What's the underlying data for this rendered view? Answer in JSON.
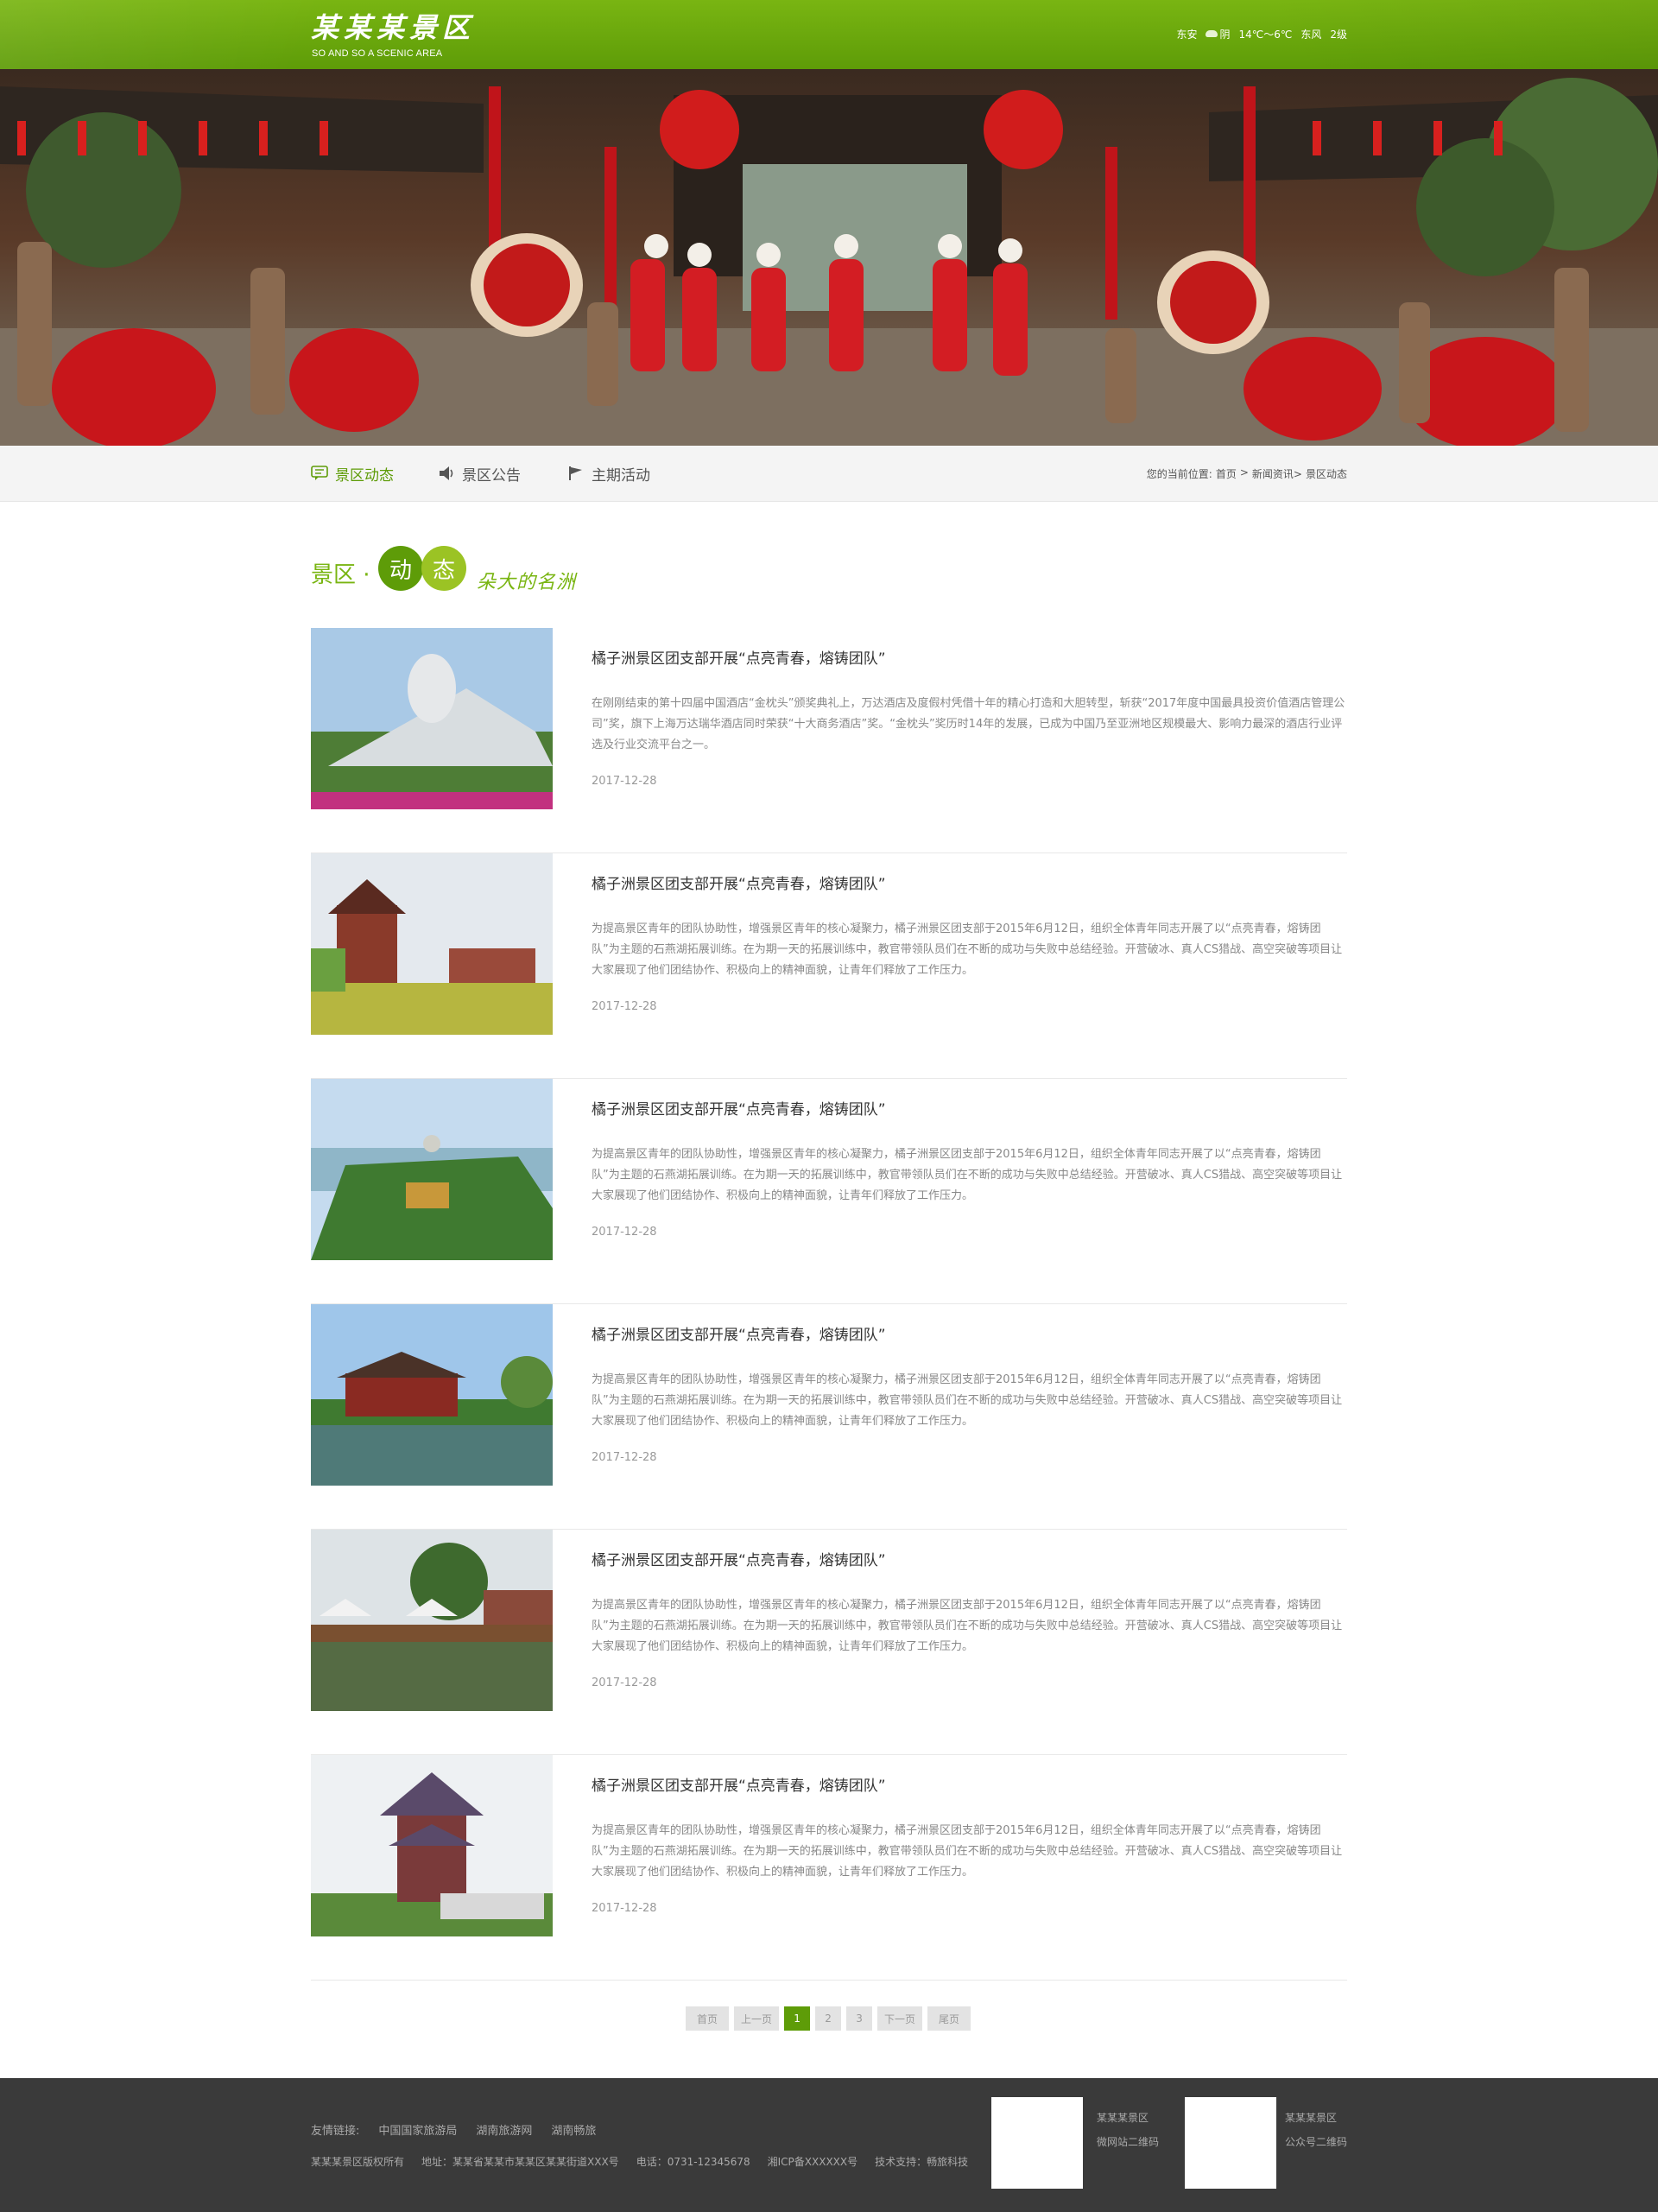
{
  "header": {
    "logo_cn": "某某某景区",
    "logo_en": "SO AND SO A SCENIC AREA",
    "weather": {
      "city": "东安",
      "condition": "阴",
      "temperature": "14℃～6℃",
      "wind": "东风",
      "level": "2级"
    }
  },
  "subnav": {
    "tabs": [
      {
        "label": "景区动态",
        "icon": "comment-icon"
      },
      {
        "label": "景区公告",
        "icon": "speaker-icon"
      },
      {
        "label": "主期活动",
        "icon": "flag-icon"
      }
    ],
    "breadcrumb": {
      "prefix": "您的当前位置:",
      "items": [
        "首页",
        ">",
        "新闻资讯>",
        "景区动态"
      ]
    }
  },
  "section": {
    "label": "景区 ·",
    "circle1": "动",
    "circle2": "态",
    "slogan": "朵大的名洲"
  },
  "news": [
    {
      "title": "橘子洲景区团支部开展“点亮青春，熔铸团队”",
      "desc": "在刚刚结束的第十四届中国酒店“金枕头”颁奖典礼上，万达酒店及度假村凭借十年的精心打造和大胆转型，斩获“2017年度中国最具投资价值酒店管理公司”奖，旗下上海万达瑞华酒店同时荣获“十大商务酒店”奖。“金枕头”奖历时14年的发展，已成为中国乃至亚洲地区规模最大、影响力最深的酒店行业评选及行业交流平台之一。",
      "date": "2017-12-28"
    },
    {
      "title": "橘子洲景区团支部开展“点亮青春，熔铸团队”",
      "desc": "为提高景区青年的团队协助性，增强景区青年的核心凝聚力，橘子洲景区团支部于2015年6月12日，组织全体青年同志开展了以“点亮青春，熔铸团队”为主题的石燕湖拓展训练。在为期一天的拓展训练中，教官带领队员们在不断的成功与失败中总结经验。开营破冰、真人CS猎战、高空突破等项目让大家展现了他们团结协作、积极向上的精神面貌，让青年们释放了工作压力。",
      "date": "2017-12-28"
    },
    {
      "title": "橘子洲景区团支部开展“点亮青春，熔铸团队”",
      "desc": "为提高景区青年的团队协助性，增强景区青年的核心凝聚力，橘子洲景区团支部于2015年6月12日，组织全体青年同志开展了以“点亮青春，熔铸团队”为主题的石燕湖拓展训练。在为期一天的拓展训练中，教官带领队员们在不断的成功与失败中总结经验。开营破冰、真人CS猎战、高空突破等项目让大家展现了他们团结协作、积极向上的精神面貌，让青年们释放了工作压力。",
      "date": "2017-12-28"
    },
    {
      "title": "橘子洲景区团支部开展“点亮青春，熔铸团队”",
      "desc": "为提高景区青年的团队协助性，增强景区青年的核心凝聚力，橘子洲景区团支部于2015年6月12日，组织全体青年同志开展了以“点亮青春，熔铸团队”为主题的石燕湖拓展训练。在为期一天的拓展训练中，教官带领队员们在不断的成功与失败中总结经验。开营破冰、真人CS猎战、高空突破等项目让大家展现了他们团结协作、积极向上的精神面貌，让青年们释放了工作压力。",
      "date": "2017-12-28"
    },
    {
      "title": "橘子洲景区团支部开展“点亮青春，熔铸团队”",
      "desc": "为提高景区青年的团队协助性，增强景区青年的核心凝聚力，橘子洲景区团支部于2015年6月12日，组织全体青年同志开展了以“点亮青春，熔铸团队”为主题的石燕湖拓展训练。在为期一天的拓展训练中，教官带领队员们在不断的成功与失败中总结经验。开营破冰、真人CS猎战、高空突破等项目让大家展现了他们团结协作、积极向上的精神面貌，让青年们释放了工作压力。",
      "date": "2017-12-28"
    },
    {
      "title": "橘子洲景区团支部开展“点亮青春，熔铸团队”",
      "desc": "为提高景区青年的团队协助性，增强景区青年的核心凝聚力，橘子洲景区团支部于2015年6月12日，组织全体青年同志开展了以“点亮青春，熔铸团队”为主题的石燕湖拓展训练。在为期一天的拓展训练中，教官带领队员们在不断的成功与失败中总结经验。开营破冰、真人CS猎战、高空突破等项目让大家展现了他们团结协作、积极向上的精神面貌，让青年们释放了工作压力。",
      "date": "2017-12-28"
    }
  ],
  "pager": {
    "first": "首页",
    "prev": "上一页",
    "pages": [
      "1",
      "2",
      "3"
    ],
    "current": "1",
    "next": "下一页",
    "last": "尾页"
  },
  "footer": {
    "links_label": "友情链接:",
    "links": [
      "中国国家旅游局",
      "湖南旅游网",
      "湖南畅旅"
    ],
    "copyright": "某某某景区版权所有",
    "address": "地址：某某省某某市某某区某某街道XXX号",
    "phone": "电话：0731-12345678",
    "icp": "湘ICP备XXXXXX号",
    "support": "技术支持：畅旅科技",
    "qr1": {
      "name": "某某某景区",
      "caption": "微网站二维码"
    },
    "qr2": {
      "name": "某某某景区",
      "caption": "公众号二维码"
    }
  },
  "colors": {
    "brand_green": "#5e9c08",
    "light_green": "#9bc324",
    "footer_bg": "#3a3a3a"
  }
}
